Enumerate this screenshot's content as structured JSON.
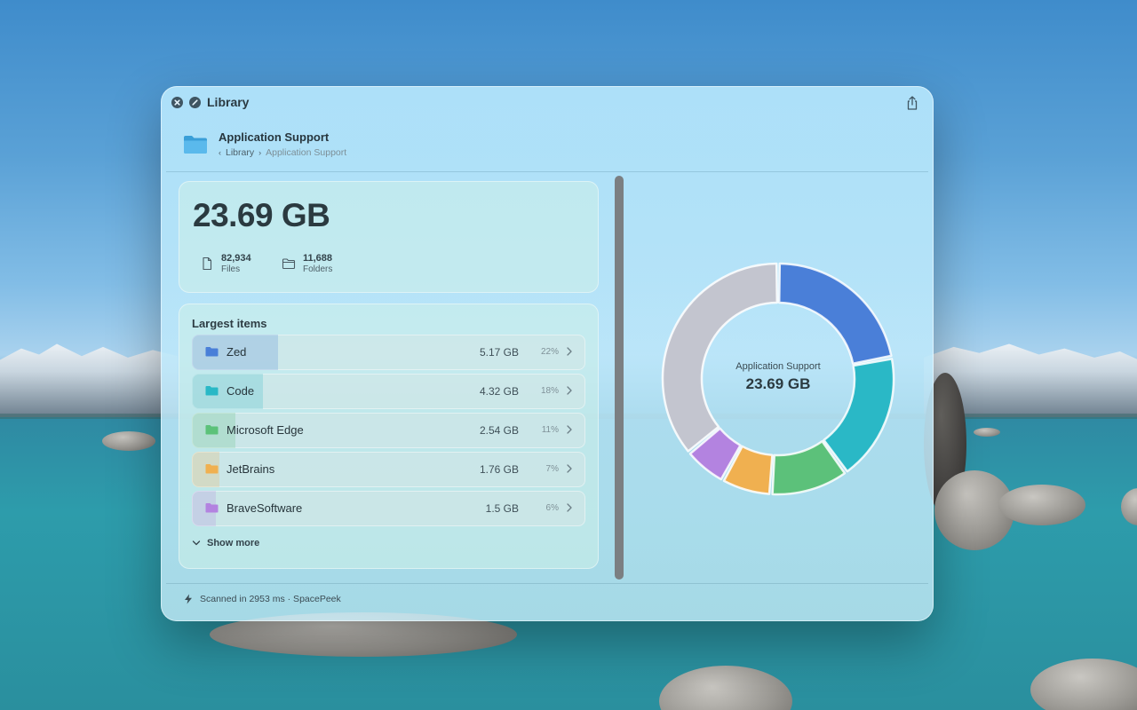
{
  "window": {
    "title": "Library"
  },
  "header": {
    "title": "Application Support",
    "breadcrumb": {
      "parent": "Library",
      "current": "Application Support"
    }
  },
  "summary": {
    "total": "23.69 GB",
    "files": {
      "value": "82,934",
      "label": "Files"
    },
    "folders": {
      "value": "11,688",
      "label": "Folders"
    }
  },
  "largest": {
    "title": "Largest items",
    "items": [
      {
        "name": "Zed",
        "size": "5.17 GB",
        "percent": "22%",
        "fraction": 0.22,
        "color": "#4a7fd8"
      },
      {
        "name": "Code",
        "size": "4.32 GB",
        "percent": "18%",
        "fraction": 0.18,
        "color": "#2ab8c6"
      },
      {
        "name": "Microsoft Edge",
        "size": "2.54 GB",
        "percent": "11%",
        "fraction": 0.11,
        "color": "#5cc17a"
      },
      {
        "name": "JetBrains",
        "size": "1.76 GB",
        "percent": "7%",
        "fraction": 0.07,
        "color": "#f0b050"
      },
      {
        "name": "BraveSoftware",
        "size": "1.5 GB",
        "percent": "6%",
        "fraction": 0.06,
        "color": "#b383e0"
      }
    ],
    "show_more": "Show more"
  },
  "chart": {
    "center_label": "Application Support",
    "center_value": "23.69 GB",
    "other_color": "#c3c5cf"
  },
  "footer": {
    "text": "Scanned in 2953 ms · SpacePeek"
  },
  "icons": {
    "close": "close-icon",
    "block": "block-icon",
    "share": "share-icon",
    "folder": "folder-icon",
    "file": "file-icon",
    "bolt": "bolt-icon"
  }
}
